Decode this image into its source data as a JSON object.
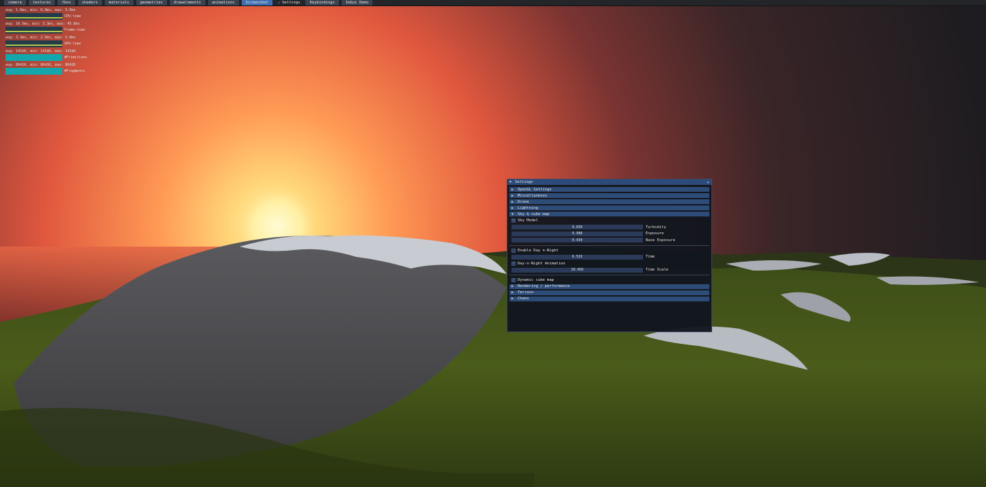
{
  "menu": {
    "items": [
      "camera",
      "textures",
      "fbos",
      "shaders",
      "materials",
      "geometries",
      "drawelements",
      "animations",
      "Screenshot"
    ],
    "active": "Screenshot",
    "checked_item": "Settings",
    "tail_items": [
      "Keybindings",
      "ImGui Demo"
    ]
  },
  "stats": [
    {
      "text": "avg: 1.6ms, min: 0.9ms, max: 5.0ms",
      "label": "CPU-time",
      "kind": "line"
    },
    {
      "text": "avg: 16.5ms, min: 3.3ms, max: 45.0ms",
      "label": "Frame-time",
      "kind": "line"
    },
    {
      "text": "avg: 3.3ms, min: 2.5ms, max: 5.0ms",
      "label": "GPU-time",
      "kind": "line"
    },
    {
      "text": "avg: 141kK, min: 141kK, max: 141kK",
      "label": "#Primitives",
      "kind": "bar"
    },
    {
      "text": "avg: 8641K, min: 8641K, max: 8642K",
      "label": "#Fragments",
      "kind": "bar"
    }
  ],
  "settings": {
    "title": "Settings",
    "headers_top": [
      "OpenGL Settings",
      "Miscellaneous",
      "Drone",
      "Lightning"
    ],
    "sky_header": "Sky & cube map",
    "sky_model": {
      "label": "Sky Model",
      "checked": true
    },
    "sky_sliders": [
      {
        "value": "9.650",
        "label": "Turbidity"
      },
      {
        "value": "9.988",
        "label": "Exposure"
      },
      {
        "value": "0.430",
        "label": "Base Exposure"
      }
    ],
    "day_night": {
      "label": "Enable Day n-Night",
      "checked": false
    },
    "time_slider": {
      "value": "6.52X",
      "label": "Time"
    },
    "day_night_anim": {
      "label": "Day-n-Night Animation",
      "checked": true
    },
    "time_scale": {
      "value": "10.450",
      "label": "Time Scale"
    },
    "dynamic_cube": {
      "label": "Dynamic cube map",
      "checked": true
    },
    "headers_bottom": [
      "Rendering / performance",
      "Terrain",
      "Chaos"
    ]
  }
}
